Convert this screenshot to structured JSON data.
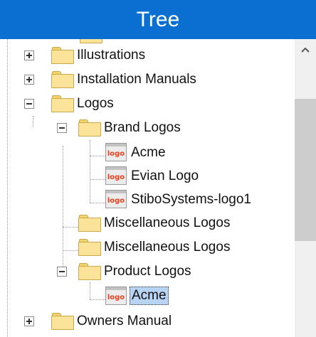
{
  "header": {
    "title": "Tree"
  },
  "tree": {
    "items": [
      {
        "label": "Illustrations",
        "type": "folder",
        "expander": "plus"
      },
      {
        "label": "Installation Manuals",
        "type": "folder",
        "expander": "plus"
      },
      {
        "label": "Logos",
        "type": "folder",
        "expander": "minus"
      },
      {
        "label": "Brand Logos",
        "type": "folder",
        "expander": "minus"
      },
      {
        "label": "Acme",
        "type": "logo",
        "icon_text": "logo"
      },
      {
        "label": "Evian Logo",
        "type": "logo",
        "icon_text": "logo"
      },
      {
        "label": "StiboSystems-logo1",
        "type": "logo",
        "icon_text": "logo"
      },
      {
        "label": "Miscellaneous Logos",
        "type": "folder"
      },
      {
        "label": "Miscellaneous Logos",
        "type": "folder"
      },
      {
        "label": "Product Logos",
        "type": "folder",
        "expander": "minus"
      },
      {
        "label": "Acme",
        "type": "logo",
        "icon_text": "logo",
        "selected": true
      },
      {
        "label": "Owners Manual",
        "type": "folder",
        "expander": "plus"
      }
    ]
  },
  "colors": {
    "header_bg": "#0a6fd1",
    "selection_bg": "#b9d3f3",
    "logo_text": "#e8401d"
  }
}
